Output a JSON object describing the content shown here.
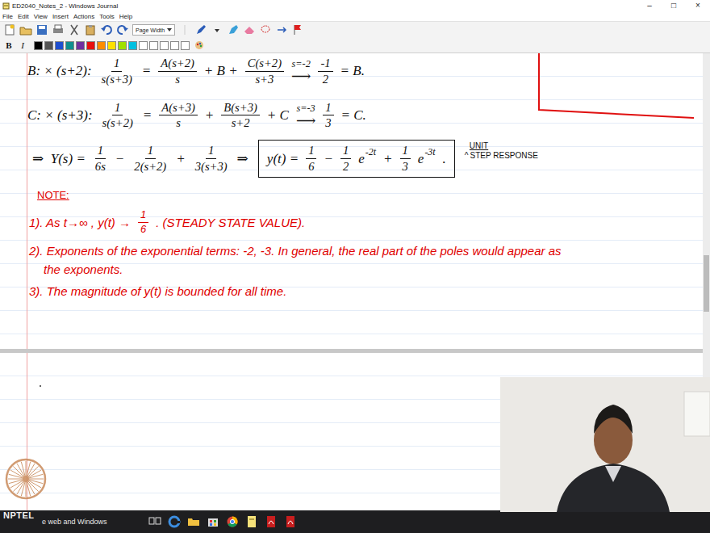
{
  "window": {
    "title": "ED2040_Notes_2 - Windows Journal",
    "controls": [
      "–",
      "□",
      "×"
    ]
  },
  "menu": [
    "File",
    "Edit",
    "View",
    "Insert",
    "Actions",
    "Tools",
    "Help"
  ],
  "toolbar": {
    "zoom": "Page Width",
    "format": [
      "B",
      "I"
    ],
    "swatches": [
      {
        "color": "#000000"
      },
      {
        "color": "#555555"
      },
      {
        "color": "#1f4fd0"
      },
      {
        "color": "#0f8f8f"
      },
      {
        "color": "#7030a0"
      },
      {
        "color": "#e81010"
      },
      {
        "color": "#ff8c00"
      },
      {
        "color": "#ffe000"
      },
      {
        "color": "#a0e000"
      },
      {
        "color": "#00c0e0"
      },
      {
        "color": "#ffffff"
      },
      {
        "color": "#ffffff"
      },
      {
        "color": "#ffffff"
      },
      {
        "color": "#ffffff"
      },
      {
        "color": "#ffffff"
      }
    ]
  },
  "page": {
    "row_b": [
      {
        "kind": "text",
        "text": "B: × (s+2):"
      },
      {
        "kind": "frac",
        "num": "1",
        "den": "s(s+3)"
      },
      {
        "kind": "text",
        "text": "="
      },
      {
        "kind": "frac",
        "num": "A(s+2)",
        "den": "s"
      },
      {
        "kind": "text",
        "text": "+ B +"
      },
      {
        "kind": "frac",
        "num": "C(s+2)",
        "den": "s+3"
      },
      {
        "kind": "arrow",
        "above": "s=-2",
        "text": "⟶"
      },
      {
        "kind": "frac",
        "num": "-1",
        "den": "2"
      },
      {
        "kind": "text",
        "text": "= B."
      }
    ],
    "row_c": [
      {
        "kind": "text",
        "text": "C: × (s+3):"
      },
      {
        "kind": "frac",
        "num": "1",
        "den": "s(s+2)"
      },
      {
        "kind": "text",
        "text": "="
      },
      {
        "kind": "frac",
        "num": "A(s+3)",
        "den": "s"
      },
      {
        "kind": "text",
        "text": "+"
      },
      {
        "kind": "frac",
        "num": "B(s+3)",
        "den": "s+2"
      },
      {
        "kind": "text",
        "text": "+ C"
      },
      {
        "kind": "arrow",
        "above": "s=-3",
        "text": "⟶"
      },
      {
        "kind": "frac",
        "num": "1",
        "den": "3"
      },
      {
        "kind": "text",
        "text": "= C."
      }
    ],
    "row_y": {
      "lead": [
        {
          "kind": "text",
          "text": "⇒  Y(s) ="
        },
        {
          "kind": "frac",
          "num": "1",
          "den": "6s"
        },
        {
          "kind": "text",
          "text": "−"
        },
        {
          "kind": "frac",
          "num": "1",
          "den": "2(s+2)"
        },
        {
          "kind": "text",
          "text": "+"
        },
        {
          "kind": "frac",
          "num": "1",
          "den": "3(s+3)"
        },
        {
          "kind": "text",
          "text": "⇒"
        }
      ],
      "boxed": [
        {
          "kind": "text",
          "text": "y(t) ="
        },
        {
          "kind": "frac",
          "num": "1",
          "den": "6"
        },
        {
          "kind": "text",
          "text": "−"
        },
        {
          "kind": "frac",
          "num": "1",
          "den": "2"
        },
        {
          "kind": "sup",
          "base": "e",
          "sup": "-2t"
        },
        {
          "kind": "text",
          "text": "+"
        },
        {
          "kind": "frac",
          "num": "1",
          "den": "3"
        },
        {
          "kind": "sup",
          "base": "e",
          "sup": "-3t"
        },
        {
          "kind": "text",
          "text": "."
        }
      ],
      "annotation": {
        "above": "UNIT",
        "caret": "^",
        "text": "STEP RESPONSE"
      }
    },
    "notes": {
      "heading": "NOTE:",
      "items": [
        {
          "lines": [
            [
              {
                "kind": "text",
                "text": "1). As t→∞ , y(t) →"
              },
              {
                "kind": "frac",
                "num": "1",
                "den": "6"
              },
              {
                "kind": "text",
                "text": ". (STEADY STATE VALUE)."
              }
            ]
          ]
        },
        {
          "lines": [
            [
              {
                "kind": "text",
                "text": "2). Exponents of the exponential terms: -2, -3. In general, the real part of the poles would appear as"
              }
            ],
            [
              {
                "kind": "text",
                "text": "the exponents."
              }
            ]
          ]
        },
        {
          "lines": [
            [
              {
                "kind": "text",
                "text": "3). The magnitude of y(t) is bounded for all time."
              }
            ]
          ]
        }
      ]
    }
  },
  "logo": {
    "text": "NPTEL"
  },
  "taskbar": {
    "search": "e web and Windows"
  }
}
